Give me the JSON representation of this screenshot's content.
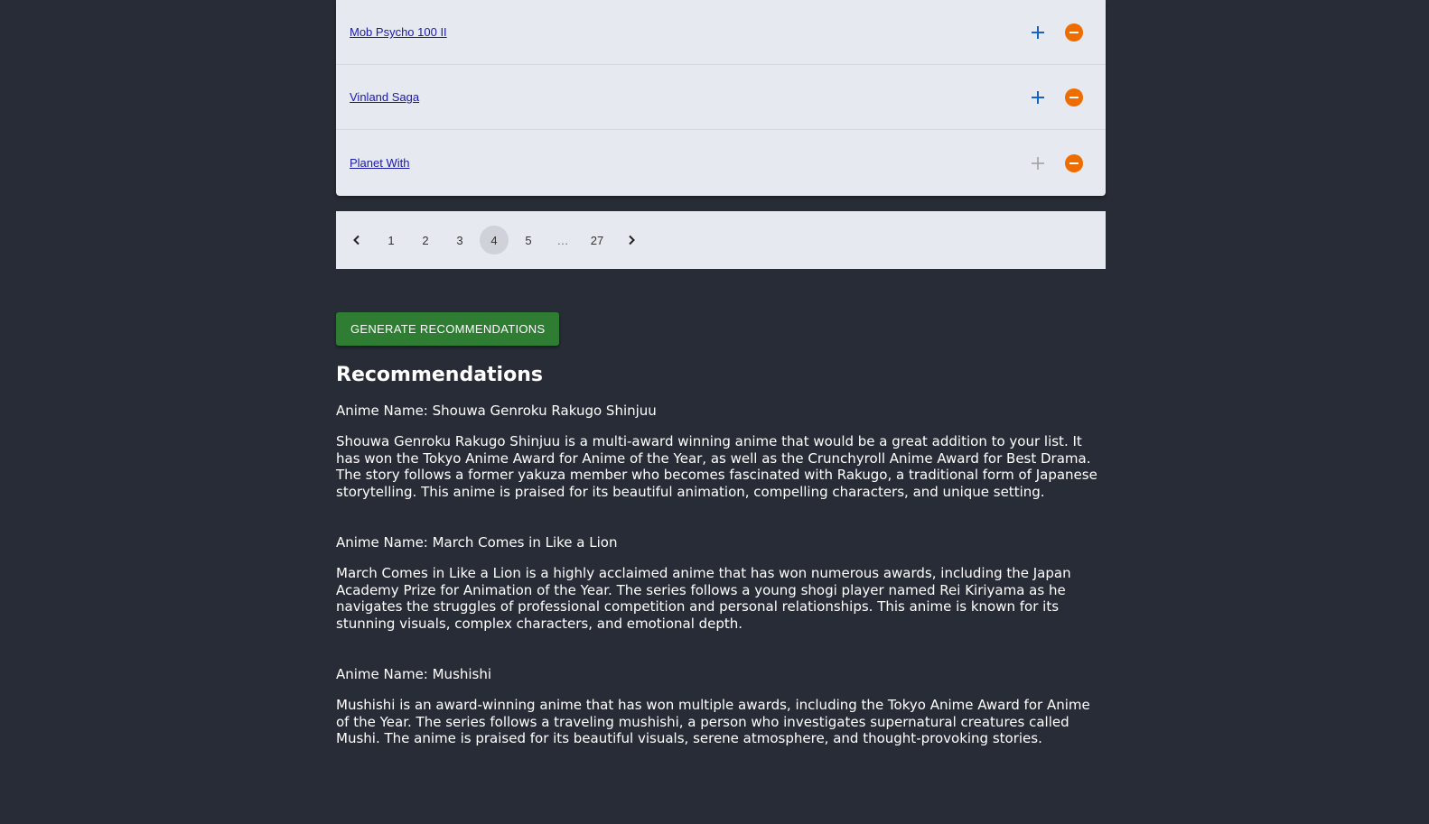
{
  "anime_list": [
    {
      "title": "Mob Psycho 100 II",
      "add_enabled": true
    },
    {
      "title": "Vinland Saga",
      "add_enabled": true
    },
    {
      "title": "Planet With",
      "add_enabled": false
    }
  ],
  "icons": {
    "add": "plus-icon",
    "remove": "minus-circle-icon",
    "prev": "chevron-left-icon",
    "next": "chevron-right-icon"
  },
  "colors": {
    "background": "#282c36",
    "card": "#e6e9ef",
    "add": "#1565c0",
    "add_disabled": "#9e9e9e",
    "remove": "#ef6c00",
    "generate_button": "#2e7d32"
  },
  "pagination": {
    "pages": [
      "1",
      "2",
      "3",
      "4",
      "5",
      "…",
      "27"
    ],
    "current": "4"
  },
  "generate_button_label": "GENERATE RECOMMENDATIONS",
  "recommendations": {
    "heading": "Recommendations",
    "items": [
      {
        "name": "Anime Name: Shouwa Genroku Rakugo Shinjuu",
        "description": "Shouwa Genroku Rakugo Shinjuu is a multi-award winning anime that would be a great addition to your list. It has won the Tokyo Anime Award for Anime of the Year, as well as the Crunchyroll Anime Award for Best Drama. The story follows a former yakuza member who becomes fascinated with Rakugo, a traditional form of Japanese storytelling. This anime is praised for its beautiful animation, compelling characters, and unique setting."
      },
      {
        "name": "Anime Name: March Comes in Like a Lion",
        "description": "March Comes in Like a Lion is a highly acclaimed anime that has won numerous awards, including the Japan Academy Prize for Animation of the Year. The series follows a young shogi player named Rei Kiriyama as he navigates the struggles of professional competition and personal relationships. This anime is known for its stunning visuals, complex characters, and emotional depth."
      },
      {
        "name": "Anime Name: Mushishi",
        "description": "Mushishi is an award-winning anime that has won multiple awards, including the Tokyo Anime Award for Anime of the Year. The series follows a traveling mushishi, a person who investigates supernatural creatures called Mushi. The anime is praised for its beautiful visuals, serene atmosphere, and thought-provoking stories."
      }
    ]
  }
}
